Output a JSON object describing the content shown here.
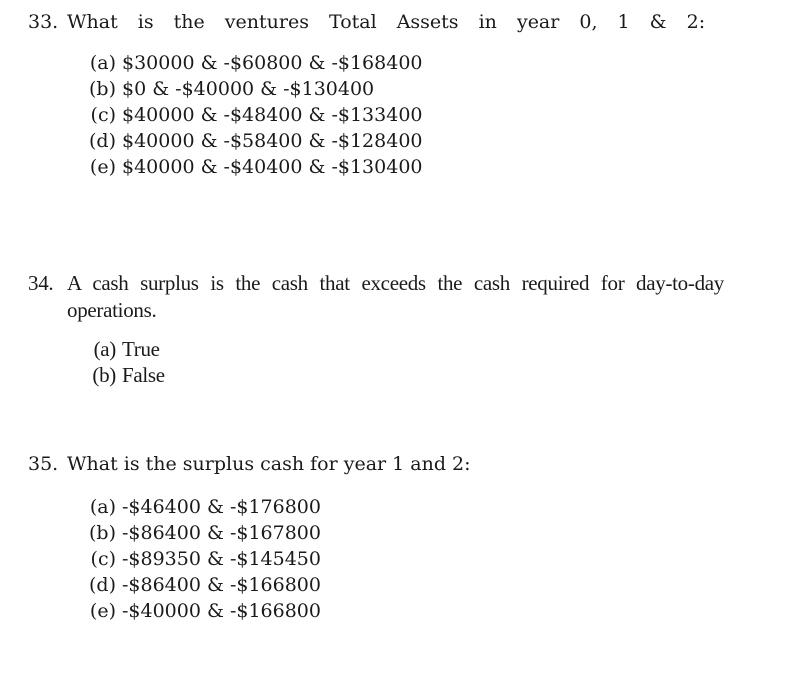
{
  "questions": [
    {
      "number": "33.",
      "text": "What is the ventures Total Assets in year 0, 1 & 2:",
      "options": [
        {
          "label": "(a)",
          "text": "$30000 & -$60800 & -$168400"
        },
        {
          "label": "(b)",
          "text": "$0 & -$40000 & -$130400"
        },
        {
          "label": "(c)",
          "text": "$40000 & -$48400 & -$133400"
        },
        {
          "label": "(d)",
          "text": "$40000 & -$58400 & -$128400"
        },
        {
          "label": "(e)",
          "text": "$40000 & -$40400 & -$130400"
        }
      ]
    },
    {
      "number": "34.",
      "text": "A cash surplus is the cash that exceeds the cash required for day-to-day operations.",
      "options": [
        {
          "label": "(a)",
          "text": "True"
        },
        {
          "label": "(b)",
          "text": "False"
        }
      ]
    },
    {
      "number": "35.",
      "text": "What is the surplus cash for year 1 and 2:",
      "options": [
        {
          "label": "(a)",
          "text": "-$46400 & -$176800"
        },
        {
          "label": "(b)",
          "text": "-$86400 & -$167800"
        },
        {
          "label": "(c)",
          "text": "-$89350 & -$145450"
        },
        {
          "label": "(d)",
          "text": "-$86400 & -$166800"
        },
        {
          "label": "(e)",
          "text": "-$40000 & -$166800"
        }
      ]
    }
  ]
}
